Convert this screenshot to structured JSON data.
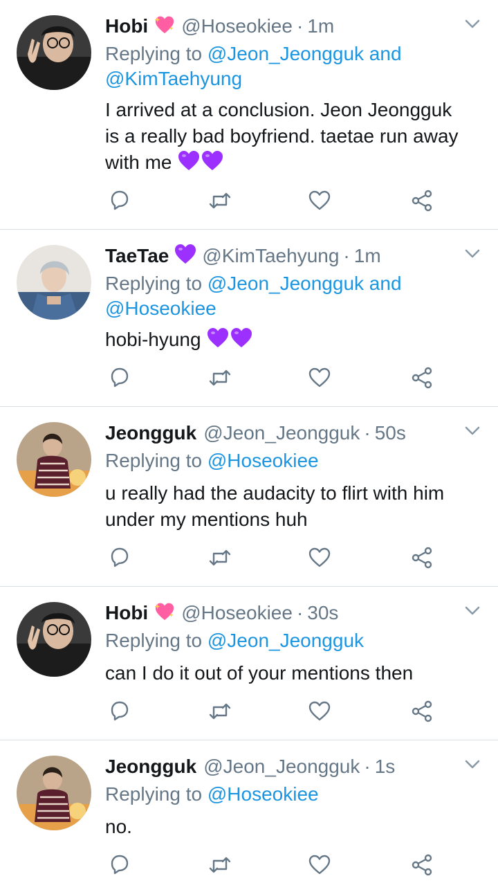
{
  "reply_prefix": "Replying to",
  "colors": {
    "accent": "#1b95e0",
    "muted": "#657786",
    "text": "#14171a",
    "purple_heart": "#9b30ff",
    "pink_heart": "#ff5fa2"
  },
  "tweets": [
    {
      "name": "Hobi",
      "name_emoji": "sparkling-heart-icon",
      "handle": "@Hoseokiee",
      "separator": "·",
      "time": "1m",
      "reply_mentions_line1": "@Jeon_Jeongguk and",
      "reply_mentions_line2": "@KimTaehyung",
      "text_lines": [
        "I arrived at a conclusion. Jeon Jeongguk",
        "is a really bad boyfriend. taetae run away",
        "with me"
      ],
      "text_emoji": "purple-hearts-icon"
    },
    {
      "name": "TaeTae",
      "name_emoji": "purple-heart-icon",
      "handle": "@KimTaehyung",
      "separator": "·",
      "time": "1m",
      "reply_mentions_line1": "@Jeon_Jeongguk and",
      "reply_mentions_line2": "@Hoseokiee",
      "text_lines": [
        "hobi-hyung"
      ],
      "text_emoji": "purple-hearts-icon"
    },
    {
      "name": "Jeongguk",
      "handle": "@Jeon_Jeongguk",
      "separator": "·",
      "time": "50s",
      "reply_mentions_line1": "@Hoseokiee",
      "text_lines": [
        "u really had the audacity to flirt with him",
        "under my mentions huh"
      ]
    },
    {
      "name": "Hobi",
      "name_emoji": "sparkling-heart-icon",
      "handle": "@Hoseokiee",
      "separator": "·",
      "time": "30s",
      "reply_mentions_line1": "@Jeon_Jeongguk",
      "text_lines": [
        "can I do it out of your mentions then"
      ]
    },
    {
      "name": "Jeongguk",
      "handle": "@Jeon_Jeongguk",
      "separator": "·",
      "time": "1s",
      "reply_mentions_line1": "@Hoseokiee",
      "text_lines": [
        "no."
      ]
    }
  ],
  "action_icons": [
    "reply-icon",
    "retweet-icon",
    "like-icon",
    "share-icon"
  ]
}
